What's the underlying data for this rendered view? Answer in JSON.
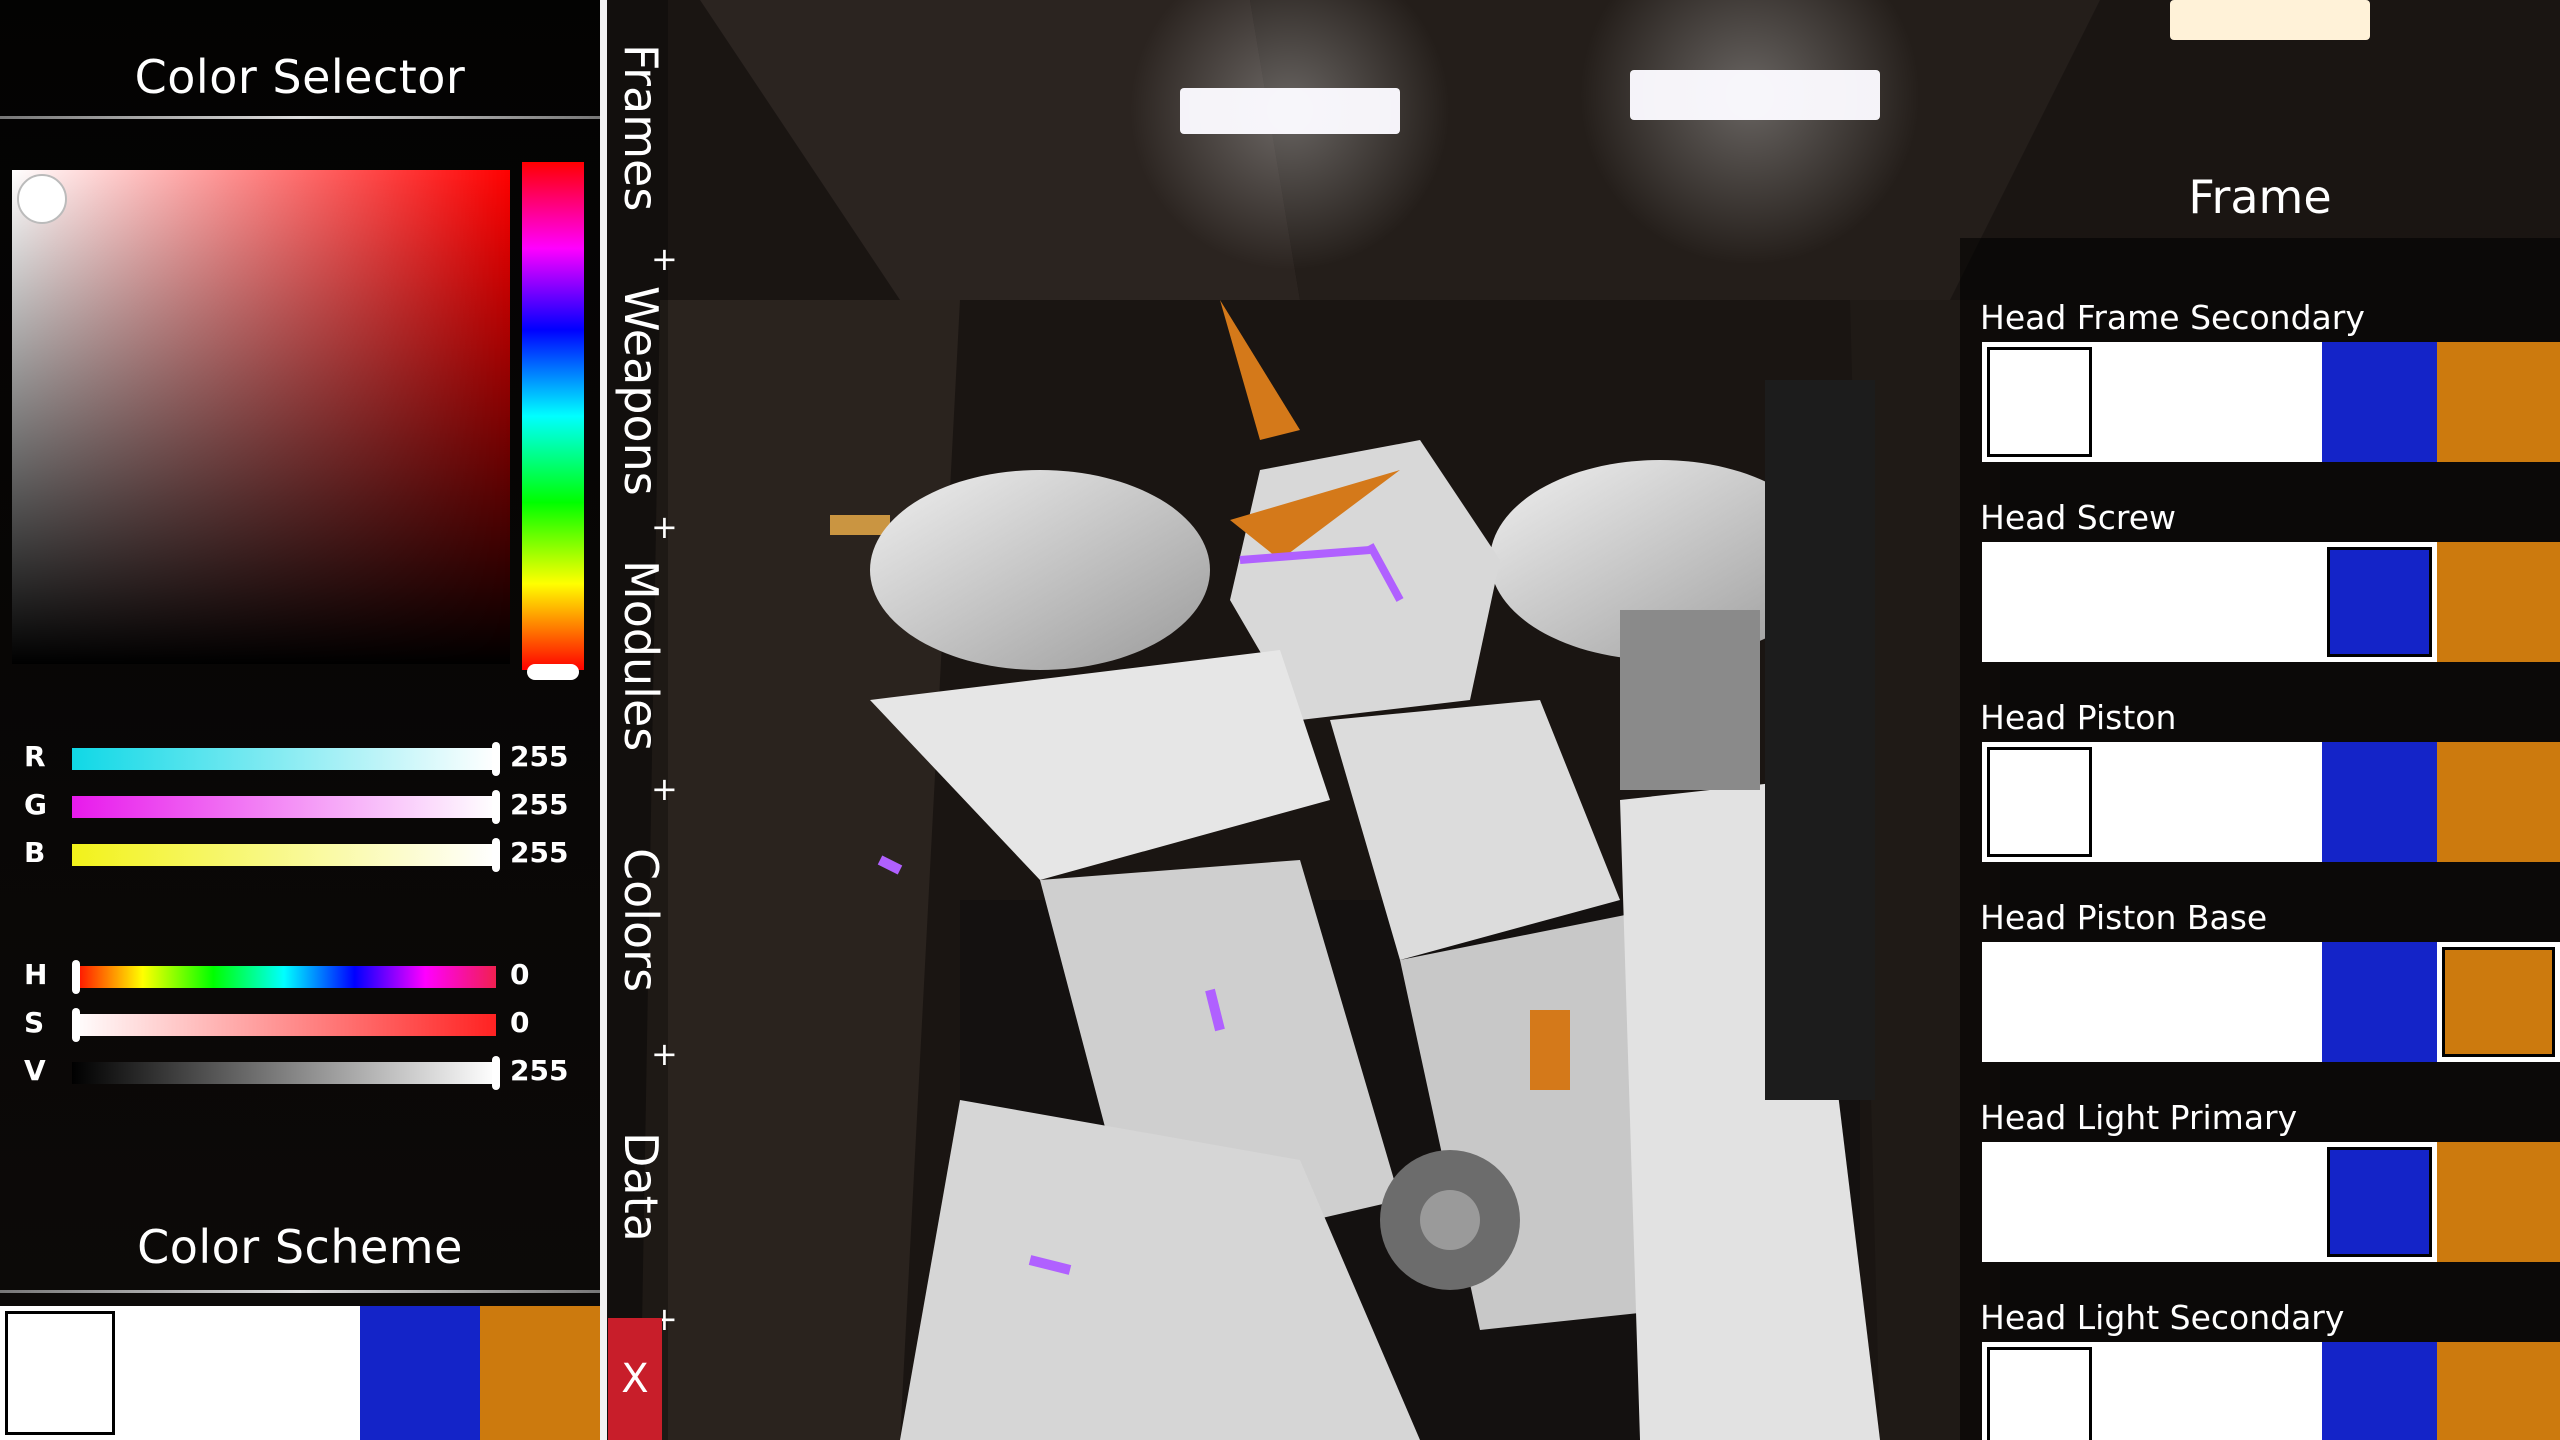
{
  "color_selector": {
    "title": "Color Selector",
    "colors": {
      "hue_base": "#ff0000"
    },
    "rgb_sliders": [
      {
        "label": "R",
        "value": "255",
        "level": 1.0
      },
      {
        "label": "G",
        "value": "255",
        "level": 1.0
      },
      {
        "label": "B",
        "value": "255",
        "level": 1.0
      }
    ],
    "hsv_sliders": [
      {
        "label": "H",
        "value": "0",
        "level": 0.0
      },
      {
        "label": "S",
        "value": "0",
        "level": 0.0
      },
      {
        "label": "V",
        "value": "255",
        "level": 1.0
      }
    ]
  },
  "color_scheme": {
    "title": "Color Scheme",
    "swatches": [
      "#ffffff",
      "#ffffff",
      "#ffffff",
      "#1424c8",
      "#cc7a0e"
    ]
  },
  "tabs": [
    {
      "label": "Frames"
    },
    {
      "label": "Weapons"
    },
    {
      "label": "Modules"
    },
    {
      "label": "Colors"
    },
    {
      "label": "Data"
    }
  ],
  "tab_plus": "+",
  "close_label": "X",
  "frame_panel": {
    "title": "Frame",
    "swatch_colors": [
      "#ffffff",
      "#ffffff",
      "#1424c8",
      "#cc7a0e"
    ],
    "entries": [
      {
        "label": "",
        "selected": 0
      },
      {
        "label": "Head Frame Secondary",
        "selected": 0
      },
      {
        "label": "Head Screw",
        "selected": 2
      },
      {
        "label": "Head Piston",
        "selected": 0
      },
      {
        "label": "Head Piston Base",
        "selected": 3
      },
      {
        "label": "Head Light Primary",
        "selected": 2
      },
      {
        "label": "Head Light Secondary",
        "selected": 0
      }
    ]
  }
}
